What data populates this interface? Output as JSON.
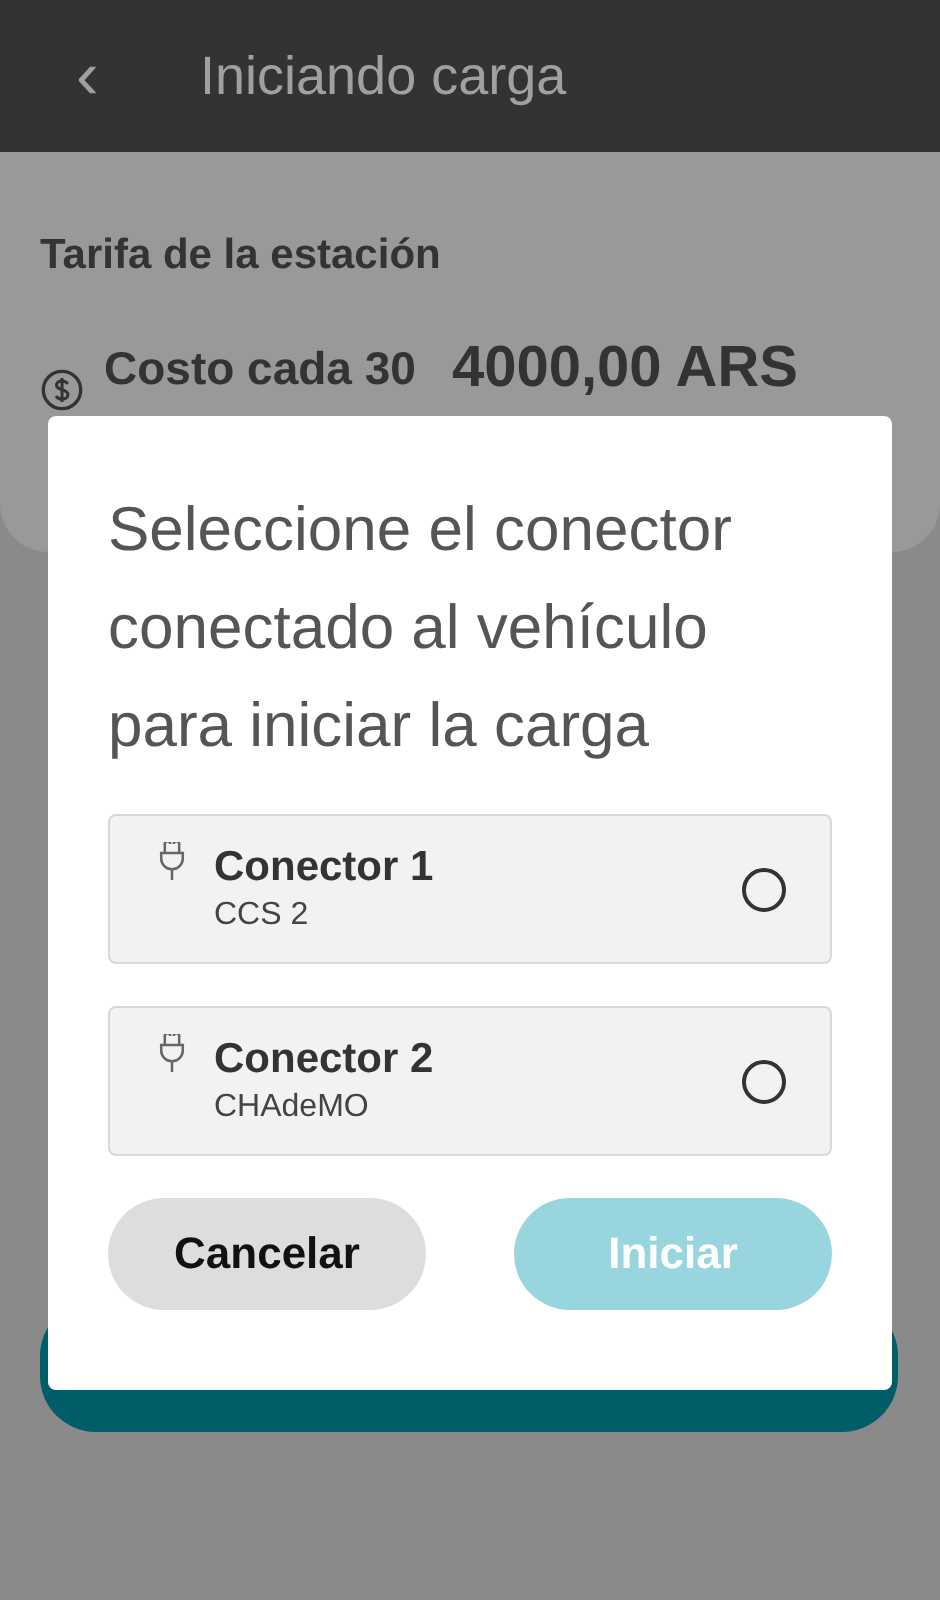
{
  "header": {
    "back_icon": "‹",
    "title": "Iniciando carga"
  },
  "rate": {
    "heading": "Tarifa de la estación",
    "label": "Costo cada 30",
    "value": "4000,00 ARS"
  },
  "dialog": {
    "title": "Seleccione el conector conectado al vehículo para iniciar la carga",
    "connectors": [
      {
        "name": "Conector 1",
        "type": "CCS 2",
        "selected": false
      },
      {
        "name": "Conector 2",
        "type": "CHAdeMO",
        "selected": false
      }
    ],
    "buttons": [
      {
        "label": "Cancelar",
        "kind": "secondary",
        "disabled": false
      },
      {
        "label": "Iniciar",
        "kind": "primary",
        "disabled": true
      }
    ]
  }
}
